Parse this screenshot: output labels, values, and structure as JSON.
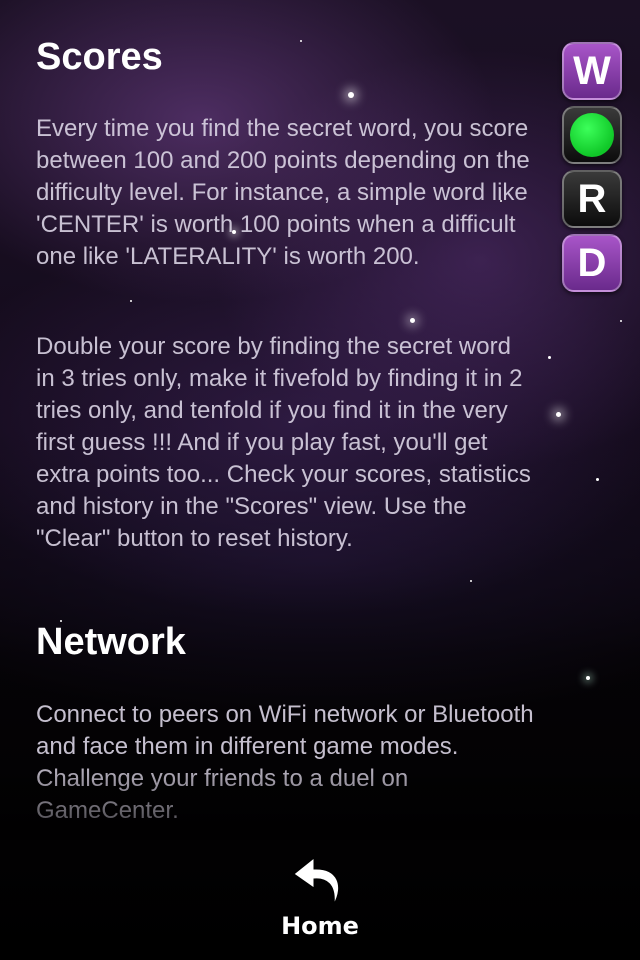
{
  "sections": [
    {
      "title": "Scores",
      "paragraphs": [
        "Every time you find the secret word, you score between 100 and 200 points depending on the difficulty level. For instance, a simple word like 'CENTER' is worth 100 points when a difficult one like 'LATERALITY' is worth 200.",
        "Double your score by finding the secret word in 3 tries only, make it fivefold by finding it in 2 tries only, and tenfold if you find it in the very first guess !!! And if you play fast, you'll get extra points too... Check your scores, statistics and history in the \"Scores\" view. Use the \"Clear\" button to reset history."
      ]
    },
    {
      "title": "Network",
      "paragraphs": [
        "Connect to peers on WiFi network or Bluetooth and face them in different game modes. Challenge your friends to a duel on GameCenter."
      ]
    }
  ],
  "logo_tiles": [
    {
      "letter": "W",
      "style": "purple"
    },
    {
      "letter": "",
      "style": "dark",
      "icon": "green-dot"
    },
    {
      "letter": "R",
      "style": "dark"
    },
    {
      "letter": "D",
      "style": "purple"
    }
  ],
  "home": {
    "label": "Home",
    "icon": "back-arrow-icon"
  },
  "colors": {
    "purple_tile": "#8a3fae",
    "green_dot": "#22e03c"
  }
}
